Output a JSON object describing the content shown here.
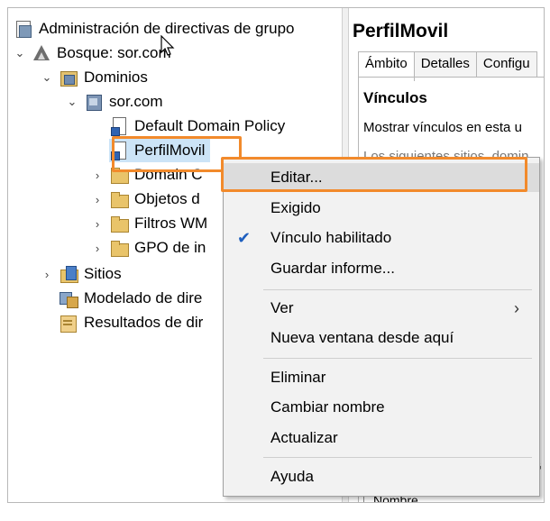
{
  "tree": {
    "root": "Administración de directivas de grupo",
    "forest": "Bosque: sor.com",
    "domains": "Dominios",
    "domain": "sor.com",
    "default_policy": "Default Domain Policy",
    "perfilmovil": "PerfilMovil",
    "domain_c": "Domain C",
    "objetos": "Objetos d",
    "filtros": "Filtros WM",
    "gpo": "GPO de in",
    "sitios": "Sitios",
    "modelado": "Modelado de dire",
    "resultados": "Resultados de dir"
  },
  "right": {
    "title": "PerfilMovil",
    "tabs": [
      "Ámbito",
      "Detalles",
      "Configu"
    ],
    "heading": "Vínculos",
    "text": "Mostrar vínculos en esta u",
    "faded": "Los siguientes sitios, domin",
    "g": "G",
    "column": "Nombre"
  },
  "menu": {
    "editar": "Editar...",
    "exigido": "Exigido",
    "vinculo": "Vínculo habilitado",
    "guardar": "Guardar informe...",
    "ver": "Ver",
    "nueva": "Nueva ventana desde aquí",
    "eliminar": "Eliminar",
    "cambiar": "Cambiar nombre",
    "actualizar": "Actualizar",
    "ayuda": "Ayuda"
  },
  "colors": {
    "highlight": "#f28a2b",
    "selection": "#cce4f7",
    "check": "#1e5fbf"
  },
  "icons": [
    "gpm-icon",
    "forest-icon",
    "domains-folder-icon",
    "domain-icon",
    "gpo-link-icon",
    "folder-icon",
    "sites-icon",
    "modeling-icon",
    "results-icon",
    "checkmark-icon",
    "chevron-right-icon"
  ]
}
